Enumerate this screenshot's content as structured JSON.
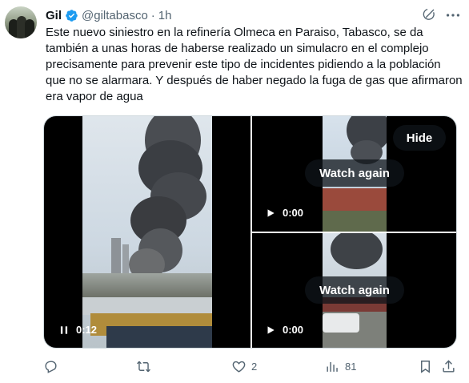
{
  "author": {
    "name": "Gil",
    "handle": "@giltabasco",
    "time": "1h",
    "verified_color": "#1d9bf0"
  },
  "tweet": {
    "text": "Este nuevo siniestro en la refinería Olmeca en Paraiso, Tabasco, se da también a unas horas de haberse realizado un simulacro en el complejo precisamente para prevenir este tipo de incidentes pidiendo a la población que no se alarmara. Y después de haber negado la fuga de gas que afirmaron era vapor de agua"
  },
  "media": {
    "main_video": {
      "timestamp": "0:12",
      "state": "paused-control",
      "icon": "pause-icon"
    },
    "top_right_video": {
      "timestamp": "0:00",
      "icon": "play-icon",
      "overlay": "Watch again",
      "hide_label": "Hide"
    },
    "bottom_right_video": {
      "timestamp": "0:00",
      "icon": "play-icon",
      "overlay": "Watch again"
    }
  },
  "actions": {
    "reply": {
      "icon": "reply-icon",
      "count": ""
    },
    "retweet": {
      "icon": "retweet-icon",
      "count": ""
    },
    "like": {
      "icon": "heart-icon",
      "count": "2"
    },
    "views": {
      "icon": "views-icon",
      "count": "81"
    },
    "bookmark": {
      "icon": "bookmark-icon"
    },
    "share": {
      "icon": "share-icon"
    }
  },
  "colors": {
    "text": "#0f1419",
    "secondary": "#536471",
    "accent": "#1d9bf0"
  }
}
